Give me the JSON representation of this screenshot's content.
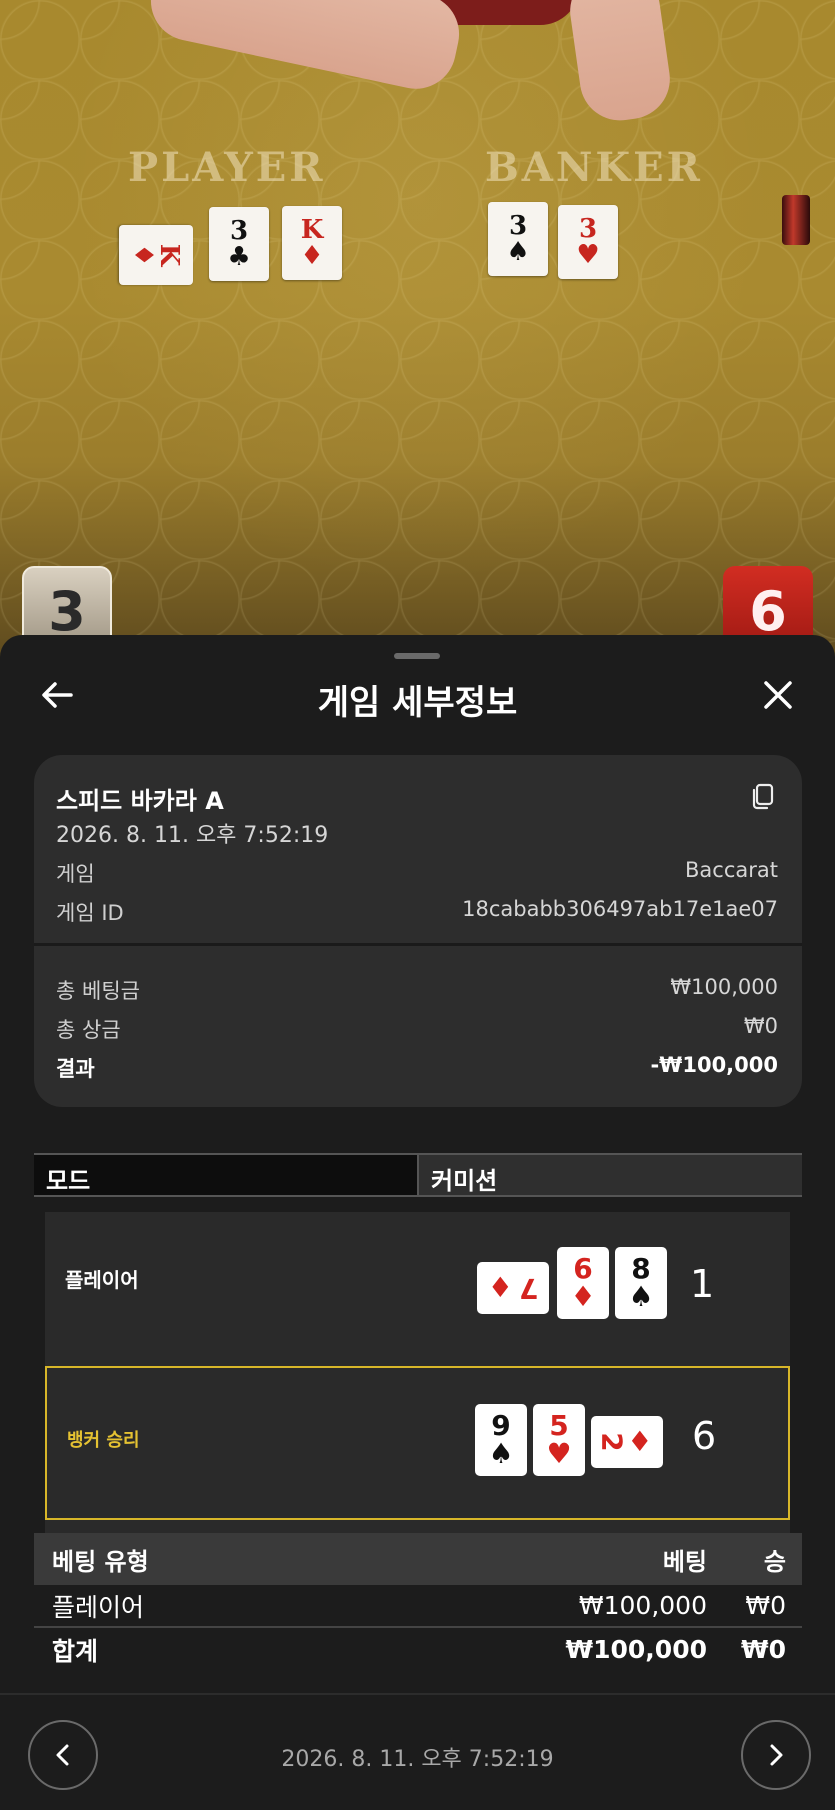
{
  "table": {
    "player_label": "PLAYER",
    "banker_label": "BANKER",
    "player_cards": [
      {
        "rank": "K",
        "suit": "♦",
        "color": "red"
      },
      {
        "rank": "3",
        "suit": "♣",
        "color": "black"
      },
      {
        "rank": "K",
        "suit": "♦",
        "color": "red"
      }
    ],
    "banker_cards": [
      {
        "rank": "3",
        "suit": "♠",
        "color": "black"
      },
      {
        "rank": "3",
        "suit": "♥",
        "color": "red"
      }
    ],
    "player_score": "3",
    "banker_score": "6"
  },
  "sheet": {
    "title": "게임 세부정보",
    "back_icon": "arrow-left-icon",
    "close_icon": "close-icon"
  },
  "info": {
    "game_name": "스피드 바카라 A",
    "timestamp": "2026. 8. 11. 오후 7:52:19",
    "game_label": "게임",
    "game_value": "Baccarat",
    "game_id_label": "게임 ID",
    "game_id_value": "18cababb306497ab17e1ae07",
    "total_bet_label": "총 베팅금",
    "total_bet_value": "₩100,000",
    "total_win_label": "총 상금",
    "total_win_value": "₩0",
    "result_label": "결과",
    "result_value": "-₩100,000",
    "copy_icon": "copy-icon"
  },
  "tabs": {
    "mode": "모드",
    "commission": "커미션"
  },
  "result": {
    "player_label": "플레이어",
    "player_score": "1",
    "player_cards": [
      {
        "rank": "7",
        "suit": "♦",
        "color": "red",
        "orientation": "side"
      },
      {
        "rank": "6",
        "suit": "♦",
        "color": "red",
        "orientation": "up"
      },
      {
        "rank": "8",
        "suit": "♠",
        "color": "black",
        "orientation": "up"
      }
    ],
    "banker_label": "뱅커 승리",
    "banker_score": "6",
    "banker_cards": [
      {
        "rank": "9",
        "suit": "♠",
        "color": "black",
        "orientation": "up"
      },
      {
        "rank": "5",
        "suit": "♥",
        "color": "red",
        "orientation": "up"
      },
      {
        "rank": "2",
        "suit": "♦",
        "color": "red",
        "orientation": "side"
      }
    ],
    "banker_accent": "#d7b629"
  },
  "bets": {
    "headers": {
      "type": "베팅 유형",
      "bet": "베팅",
      "win": "승"
    },
    "rows": [
      {
        "type": "플레이어",
        "bet": "₩100,000",
        "win": "₩0"
      }
    ],
    "total": {
      "type": "합계",
      "bet": "₩100,000",
      "win": "₩0"
    }
  },
  "footer": {
    "date": "2026. 8. 11. 오후 7:52:19",
    "prev_icon": "chevron-left-icon",
    "next_icon": "chevron-right-icon"
  }
}
